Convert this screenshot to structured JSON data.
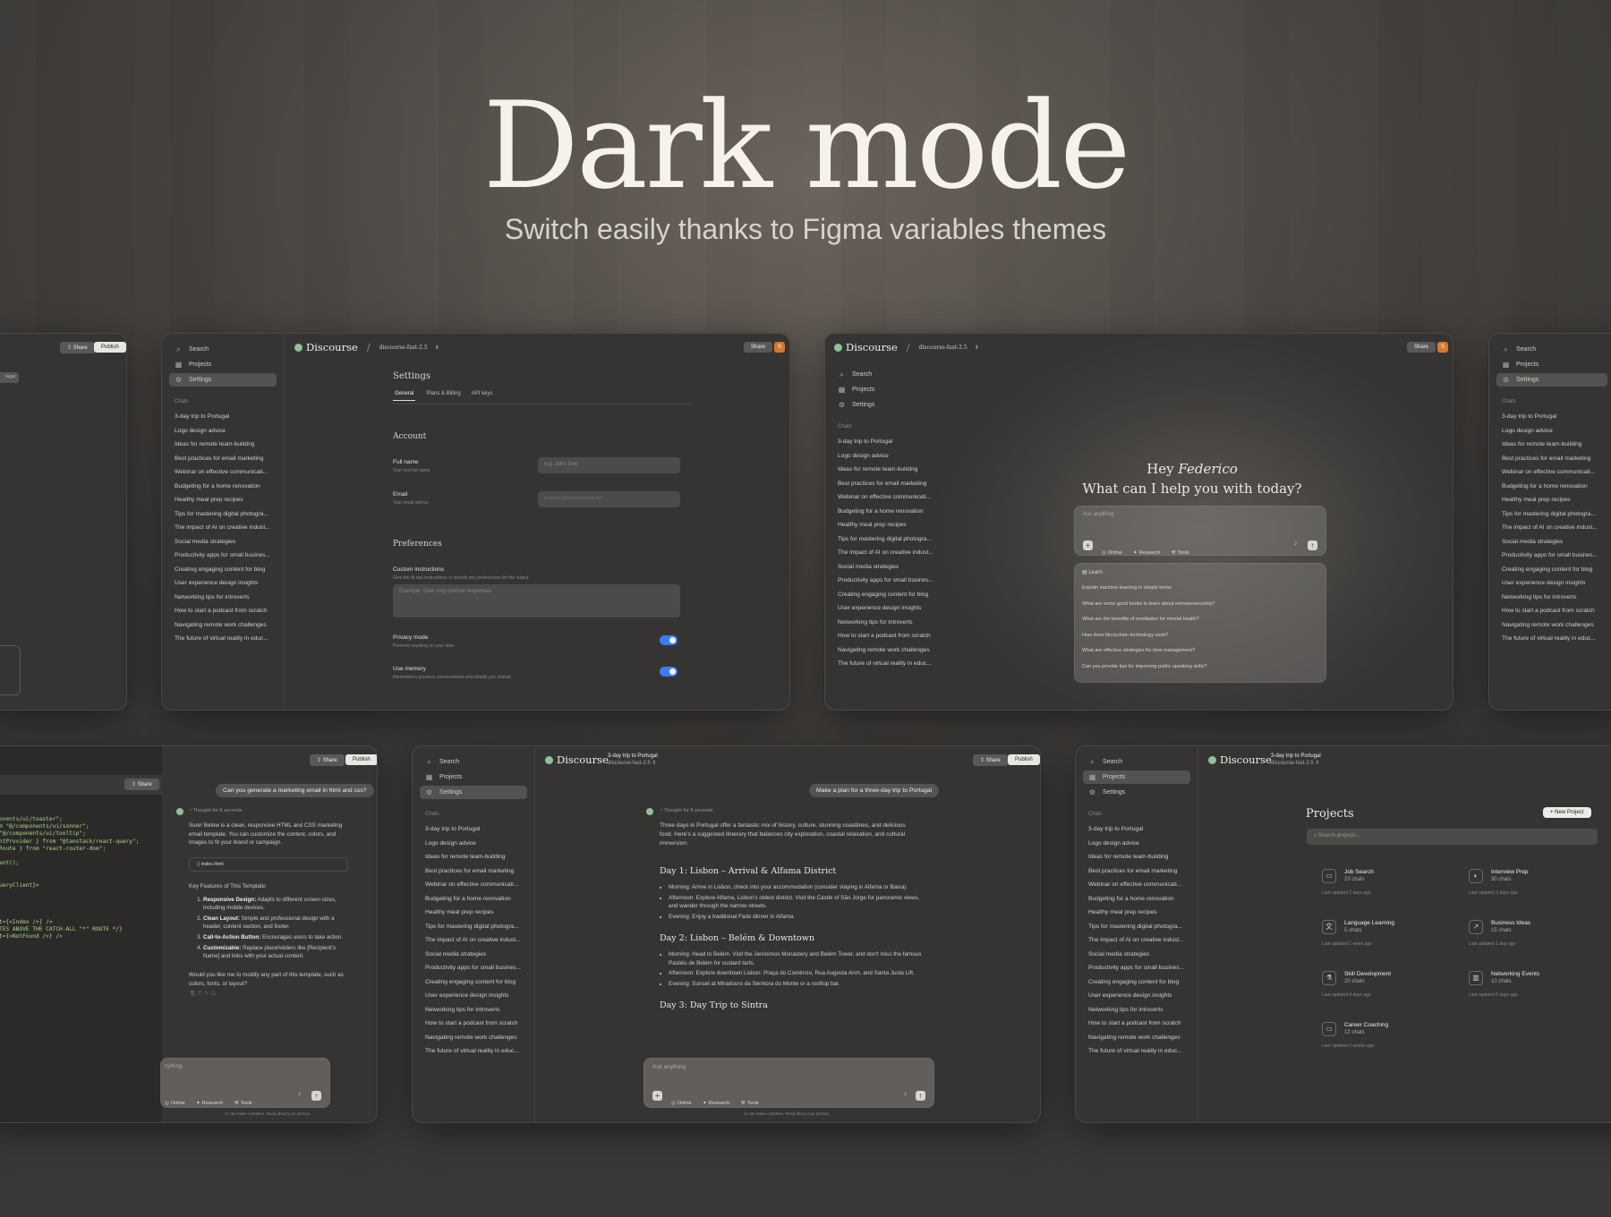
{
  "hero": {
    "title": "Dark mode",
    "subtitle": "Switch easily thanks to Figma variables themes"
  },
  "brand": "Discourse",
  "model": "discourse-fast-2.5",
  "nav": {
    "search": "Search",
    "projects": "Projects",
    "settings": "Settings",
    "chats_heading": "Chats"
  },
  "chats": [
    "3-day trip to Portugal",
    "Logo design advice",
    "Ideas for remote team-building",
    "Best practices for email marketing",
    "Webinar on effective communicati...",
    "Budgeting for a home renovation",
    "Healthy meal prep recipes",
    "Tips for mastering digital photogra...",
    "The impact of AI on creative indust...",
    "Social media strategies",
    "Productivity apps for small busines...",
    "Creating engaging content for blog",
    "User experience design insights",
    "Networking tips for introverts",
    "How to start a podcast from scratch",
    "Navigating remote work challenges",
    "The future of virtual reality in educ..."
  ],
  "buttons": {
    "share": "Share",
    "publish": "Publish",
    "avatar": "S",
    "new_project": "+ New Project"
  },
  "settings": {
    "title": "Settings",
    "tabs": [
      "General",
      "Plans & Billing",
      "API keys"
    ],
    "account": "Account",
    "full_name": "Full name",
    "full_name_sub": "Your real full name",
    "full_name_ph": "e.g. John Doe",
    "email": "Email",
    "email_sub": "Your email adress",
    "email_ph": "example@federicocerola.com",
    "preferences": "Preferences",
    "custom": "Custom instructions",
    "custom_sub": "Give the AI any instructions or specify any preferences for the output",
    "custom_ph": "Example: Give only concise responses",
    "privacy": "Privacy mode",
    "privacy_sub": "Prevents learning on your data",
    "memory": "Use memory",
    "memory_sub": "Remembers previous conversations and details you shared"
  },
  "home": {
    "greet_a": "Hey ",
    "greet_name": "Federico",
    "greet_b": "What can I help you with today?",
    "ask": "Ask anything",
    "learn": "Learn",
    "suggestions": [
      "Explain machine learning in simple terms",
      "What are some good books to learn about entrepreneurship?",
      "What are the benefits of meditation for mental health?",
      "How does blockchain technology work?",
      "What are effective strategies for time management?",
      "Can you provide tips for improving public speaking skills?"
    ]
  },
  "tools": {
    "online": "Online",
    "research": "Research",
    "tools": "Tools"
  },
  "code_chat": {
    "user": "Can you generate a marketing email in html and css?",
    "thought": "Thought for 8 seconds",
    "intro": "Sure! Below is a clean, responsive HTML and CSS marketing email template. You can customize the content, colors, and images to fit your brand or campaign.",
    "file": "index.html",
    "features_head": "Key Features of This Template:",
    "features": [
      {
        "b": "Responsive Design:",
        "t": " Adapts to different screen sizes, including mobile devices."
      },
      {
        "b": "Clean Layout:",
        "t": " Simple and professional design with a header, content section, and footer."
      },
      {
        "b": "Call-to-Action Button:",
        "t": " Encourages users to take action."
      },
      {
        "b": "Customizable:",
        "t": " Replace placeholders like [Recipient's Name] and links with your actual content."
      }
    ],
    "outro": "Would you like me to modify any part of this template, such as colors, fonts, or layout?",
    "ask": "nything",
    "code": "onents/ui/toaster\";\nm \"@/components/ui/sonner\";\n\"@/components/ui/tooltip\";\nntProvider } from \"@tanstack/react-query\";\nRoute } from \"react-router-dom\";\n\nent();\n\n\nueryClient}>\n\n\n\n\nt={<Index />} />\nTES ABOVE THE CATCH-ALL \"*\" ROUTE */}\nt={<NotFound />} />"
  },
  "trip": {
    "crumb_title": "3-day trip to Portugal",
    "user": "Make a plan for a three-day trip to Portugal",
    "thought": "Thought for 8 seconds",
    "intro": "Three days in Portugal offer a fantastic mix of history, culture, stunning coastlines, and delicious food. Here's a suggested itinerary that balances city exploration, coastal relaxation, and cultural immersion:",
    "days": [
      {
        "title": "Day 1: Lisbon – Arrival & Alfama District",
        "items": [
          "Morning: Arrive in Lisbon, check into your accommodation (consider staying in Alfama or Baixa).",
          "Afternoon: Explore Alfama, Lisbon's oldest district. Visit the Castle of São Jorge for panoramic views, and wander through the narrow streets.",
          "Evening: Enjoy a traditional Fado dinner in Alfama."
        ]
      },
      {
        "title": "Day 2: Lisbon – Belém & Downtown",
        "items": [
          "Morning: Head to Belém. Visit the Jerónimos Monastery and Belém Tower, and don't miss the famous Pastéis de Belém for custard tarts.",
          "Afternoon: Explore downtown Lisbon: Praça do Comércio, Rua Augusta Arch, and Santa Justa Lift.",
          "Evening: Sunset at Miradouro da Senhora do Monte or a rooftop bar."
        ]
      },
      {
        "title": "Day 3: Day Trip to Sintra",
        "items": []
      }
    ],
    "disclaimer": "AI can make mistakes. Read about your privacy."
  },
  "projects": {
    "title": "Projects",
    "search_ph": "Search projects...",
    "items": [
      {
        "name": "Job Search",
        "count": "23 chats",
        "updated": "Last updated 2 days ago",
        "icon": "▭"
      },
      {
        "name": "Interview Prep",
        "count": "30 chats",
        "updated": "Last updated 3 days ago",
        "icon": "◐"
      },
      {
        "name": "Language Learning",
        "count": "5 chats",
        "updated": "Last updated 1 week ago",
        "icon": "文"
      },
      {
        "name": "Business Ideas",
        "count": "15 chats",
        "updated": "Last updated 1 day ago",
        "icon": "↗"
      },
      {
        "name": "Skill Development",
        "count": "20 chats",
        "updated": "Last updated 4 days ago",
        "icon": "⚗"
      },
      {
        "name": "Networking Events",
        "count": "10 chats",
        "updated": "Last updated 5 days ago",
        "icon": "▥"
      },
      {
        "name": "Career Coaching",
        "count": "12 chats",
        "updated": "Last updated 2 weeks ago",
        "icon": "▭"
      }
    ]
  }
}
